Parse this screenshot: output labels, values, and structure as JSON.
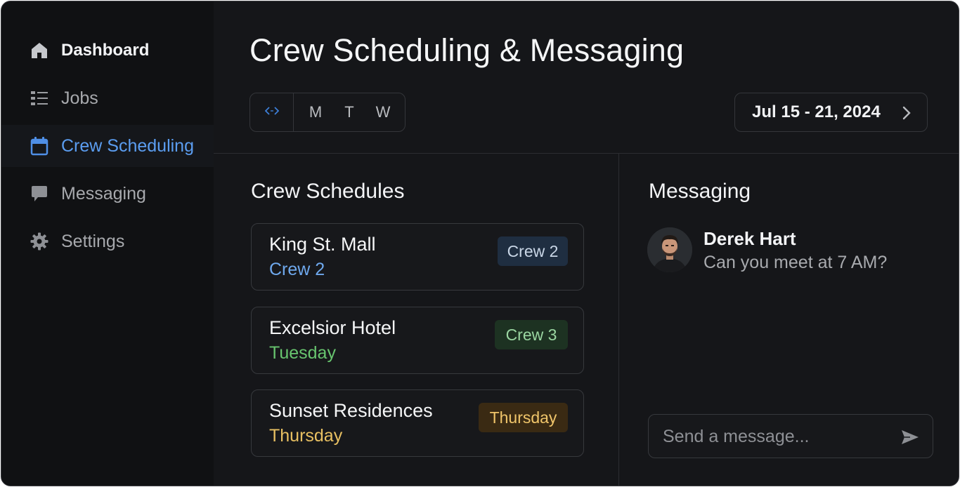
{
  "sidebar": {
    "items": [
      {
        "label": "Dashboard",
        "icon": "home-icon"
      },
      {
        "label": "Jobs",
        "icon": "list-icon"
      },
      {
        "label": "Crew Scheduling",
        "icon": "calendar-icon",
        "active": true
      },
      {
        "label": "Messaging",
        "icon": "chat-bubble-icon"
      },
      {
        "label": "Settings",
        "icon": "gear-icon"
      }
    ]
  },
  "header": {
    "title": "Crew Scheduling & Messaging",
    "days": [
      "M",
      "T",
      "W"
    ],
    "date_range": "Jul 15 - 21, 2024"
  },
  "schedules": {
    "title": "Crew Schedules",
    "cards": [
      {
        "name": "King St. Mall",
        "sub": "Crew 2",
        "badge": "Crew 2"
      },
      {
        "name": "Excelsior Hotel",
        "sub": "Tuesday",
        "badge": "Crew 3"
      },
      {
        "name": "Sunset Residences",
        "sub": "Thursday",
        "badge": "Thursday"
      }
    ]
  },
  "messaging": {
    "title": "Messaging",
    "thread": {
      "sender": "Derek Hart",
      "preview": "Can you meet at 7 AM?"
    },
    "composer_placeholder": "Send a message..."
  },
  "colors": {
    "accent": "#5b9df0",
    "background": "#151619",
    "sidebar": "#101113",
    "green": "#68c56f",
    "amber": "#e8c062"
  }
}
